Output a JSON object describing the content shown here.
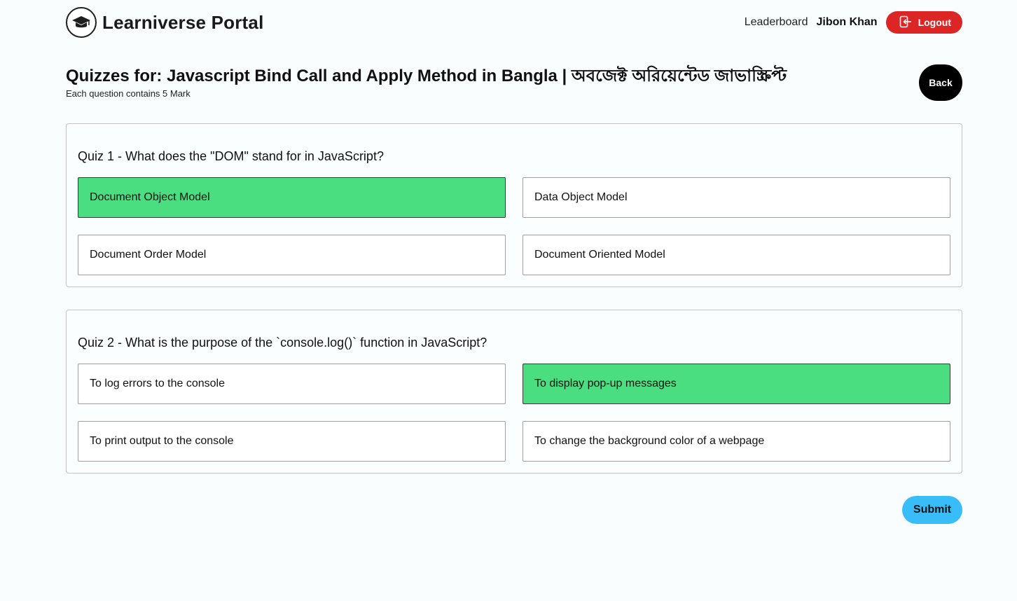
{
  "header": {
    "brand_title": "Learniverse Portal",
    "brand_icon": "graduation-cap-icon",
    "nav": {
      "leaderboard_label": "Leaderboard",
      "user_name": "Jibon Khan",
      "logout_label": "Logout",
      "logout_icon": "logout-icon"
    }
  },
  "page": {
    "title": "Quizzes for: Javascript Bind Call and Apply Method in Bangla | অবজেক্ট অরিয়েন্টেড জাভাস্ক্রিপ্ট",
    "subtitle": "Each question contains 5 Mark",
    "back_label": "Back"
  },
  "quizzes": [
    {
      "question": "Quiz 1 - What does the \"DOM\" stand for in JavaScript?",
      "options": [
        {
          "label": "Document Object Model",
          "selected": true
        },
        {
          "label": "Data Object Model",
          "selected": false
        },
        {
          "label": "Document Order Model",
          "selected": false
        },
        {
          "label": "Document Oriented Model",
          "selected": false
        }
      ]
    },
    {
      "question": "Quiz 2 - What is the purpose of the `console.log()` function in JavaScript?",
      "options": [
        {
          "label": "To log errors to the console",
          "selected": false
        },
        {
          "label": "To display pop-up messages",
          "selected": true
        },
        {
          "label": "To print output to the console",
          "selected": false
        },
        {
          "label": "To change the background color of a webpage",
          "selected": false
        }
      ]
    }
  ],
  "submit_label": "Submit",
  "colors": {
    "selected_option": "#4ade80",
    "logout": "#dc2626",
    "submit": "#38bdf8",
    "back": "#000000"
  }
}
